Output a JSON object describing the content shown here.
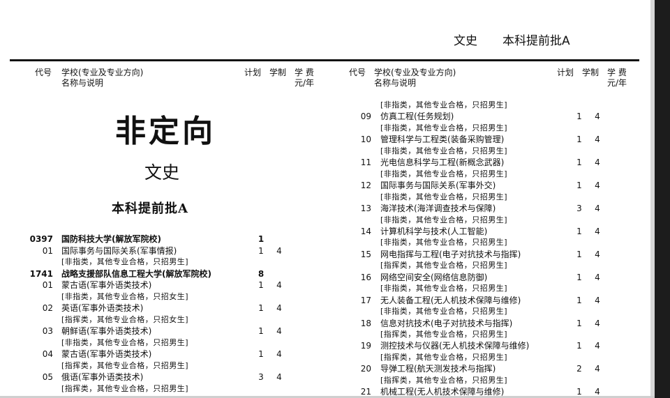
{
  "header": {
    "category": "文史",
    "batch": "本科提前批A"
  },
  "columns": {
    "code": "代号",
    "school_line1": "学校(专业及专业方向)",
    "school_line2": "名称与说明",
    "plan": "计划",
    "years": "学制",
    "fee_line1": "学 费",
    "fee_line2": "元/年"
  },
  "left": {
    "big_title": "非定向",
    "sub_title": "文史",
    "batch_title": "本科提前批A",
    "rows": [
      {
        "type": "school",
        "code": "0397",
        "name": "国防科技大学(解放军院校)",
        "plan": "1",
        "years": ""
      },
      {
        "type": "major",
        "code": "01",
        "name": "国际事务与国际关系(军事情报)",
        "plan": "1",
        "years": "4"
      },
      {
        "type": "note",
        "code": "",
        "name": "[非指类，其他专业合格，只招男生]",
        "plan": "",
        "years": ""
      },
      {
        "type": "school",
        "code": "1741",
        "name": "战略支援部队信息工程大学(解放军院校)",
        "plan": "8",
        "years": ""
      },
      {
        "type": "major",
        "code": "01",
        "name": "蒙古语(军事外语类技术)",
        "plan": "1",
        "years": "4"
      },
      {
        "type": "note",
        "code": "",
        "name": "[非指类，其他专业合格，只招女生]",
        "plan": "",
        "years": ""
      },
      {
        "type": "major",
        "code": "02",
        "name": "英语(军事外语类技术)",
        "plan": "1",
        "years": "4"
      },
      {
        "type": "note",
        "code": "",
        "name": "[指挥类，其他专业合格，只招女生]",
        "plan": "",
        "years": ""
      },
      {
        "type": "major",
        "code": "03",
        "name": "朝鲜语(军事外语类技术)",
        "plan": "1",
        "years": "4"
      },
      {
        "type": "note",
        "code": "",
        "name": "[非指类，其他专业合格，只招男生]",
        "plan": "",
        "years": ""
      },
      {
        "type": "major",
        "code": "04",
        "name": "蒙古语(军事外语类技术)",
        "plan": "1",
        "years": "4"
      },
      {
        "type": "note",
        "code": "",
        "name": "[指挥类，其他专业合格，只招男生]",
        "plan": "",
        "years": ""
      },
      {
        "type": "major",
        "code": "05",
        "name": "俄语(军事外语类技术)",
        "plan": "3",
        "years": "4"
      },
      {
        "type": "note",
        "code": "",
        "name": "[指挥类，其他专业合格，只招男生]",
        "plan": "",
        "years": ""
      }
    ]
  },
  "right": {
    "rows": [
      {
        "type": "note",
        "code": "",
        "name": "[非指类，其他专业合格，只招男生]",
        "plan": "",
        "years": ""
      },
      {
        "type": "major",
        "code": "09",
        "name": "仿真工程(任务规划)",
        "plan": "1",
        "years": "4"
      },
      {
        "type": "note",
        "code": "",
        "name": "[非指类，其他专业合格，只招男生]",
        "plan": "",
        "years": ""
      },
      {
        "type": "major",
        "code": "10",
        "name": "管理科学与工程类(装备采购管理)",
        "plan": "1",
        "years": "4"
      },
      {
        "type": "note",
        "code": "",
        "name": "[非指类，其他专业合格，只招男生]",
        "plan": "",
        "years": ""
      },
      {
        "type": "major",
        "code": "11",
        "name": "光电信息科学与工程(新概念武器)",
        "plan": "1",
        "years": "4"
      },
      {
        "type": "note",
        "code": "",
        "name": "[非指类，其他专业合格，只招男生]",
        "plan": "",
        "years": ""
      },
      {
        "type": "major",
        "code": "12",
        "name": "国际事务与国际关系(军事外交)",
        "plan": "1",
        "years": "4"
      },
      {
        "type": "note",
        "code": "",
        "name": "[非指类，其他专业合格，只招男生]",
        "plan": "",
        "years": ""
      },
      {
        "type": "major",
        "code": "13",
        "name": "海洋技术(海洋调查技术与保障)",
        "plan": "3",
        "years": "4"
      },
      {
        "type": "note",
        "code": "",
        "name": "[非指类，其他专业合格，只招男生]",
        "plan": "",
        "years": ""
      },
      {
        "type": "major",
        "code": "14",
        "name": "计算机科学与技术(人工智能)",
        "plan": "1",
        "years": "4"
      },
      {
        "type": "note",
        "code": "",
        "name": "[非指类，其他专业合格，只招男生]",
        "plan": "",
        "years": ""
      },
      {
        "type": "major",
        "code": "15",
        "name": "网电指挥与工程(电子对抗技术与指挥)",
        "plan": "1",
        "years": "4"
      },
      {
        "type": "note",
        "code": "",
        "name": "[指挥类，其他专业合格，只招男生]",
        "plan": "",
        "years": ""
      },
      {
        "type": "major",
        "code": "16",
        "name": "网络空间安全(网络信息防御)",
        "plan": "1",
        "years": "4"
      },
      {
        "type": "note",
        "code": "",
        "name": "[非指类，其他专业合格，只招男生]",
        "plan": "",
        "years": ""
      },
      {
        "type": "major",
        "code": "17",
        "name": "无人装备工程(无人机技术保障与维修)",
        "plan": "1",
        "years": "4"
      },
      {
        "type": "note",
        "code": "",
        "name": "[非指类，其他专业合格，只招男生]",
        "plan": "",
        "years": ""
      },
      {
        "type": "major",
        "code": "18",
        "name": "信息对抗技术(电子对抗技术与指挥)",
        "plan": "1",
        "years": "4"
      },
      {
        "type": "note",
        "code": "",
        "name": "[指挥类，其他专业合格，只招男生]",
        "plan": "",
        "years": ""
      },
      {
        "type": "major",
        "code": "19",
        "name": "测控技术与仪器(无人机技术保障与维修)",
        "plan": "1",
        "years": "4"
      },
      {
        "type": "note",
        "code": "",
        "name": "[指挥类，其他专业合格，只招男生]",
        "plan": "",
        "years": ""
      },
      {
        "type": "major",
        "code": "20",
        "name": "导弹工程(航天测发技术与指挥)",
        "plan": "2",
        "years": "4"
      },
      {
        "type": "note",
        "code": "",
        "name": "[指挥类，其他专业合格，只招男生]",
        "plan": "",
        "years": ""
      },
      {
        "type": "major",
        "code": "21",
        "name": "机械工程(无人机技术保障与维修)",
        "plan": "1",
        "years": "4"
      }
    ]
  }
}
